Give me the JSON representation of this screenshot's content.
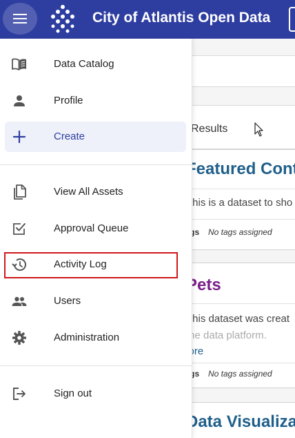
{
  "header": {
    "title": "City of Atlantis Open Data",
    "bg_color": "#2e3ea0",
    "menu_icon": "hamburger-menu-icon",
    "logo_icon": "diamond-dots-logo"
  },
  "drawer": {
    "primary_items": [
      {
        "label": "Data Catalog",
        "icon": "book-open-icon"
      },
      {
        "label": "Profile",
        "icon": "person-icon"
      },
      {
        "label": "Create",
        "icon": "plus-icon",
        "active": true
      }
    ],
    "secondary_items": [
      {
        "label": "View All Assets",
        "icon": "copy-documents-icon"
      },
      {
        "label": "Approval Queue",
        "icon": "checkbox-icon"
      },
      {
        "label": "Activity Log",
        "icon": "history-icon",
        "highlighted": true
      },
      {
        "label": "Users",
        "icon": "people-icon"
      },
      {
        "label": "Administration",
        "icon": "gear-icon"
      }
    ],
    "footer_items": [
      {
        "label": "Sign out",
        "icon": "sign-out-icon"
      }
    ],
    "highlight_color": "#d0161b"
  },
  "background": {
    "results_label": "Results",
    "cards": [
      {
        "title": "Featured Cont",
        "description": "This is a dataset to sho",
        "tags_key": "Tags",
        "tags_value": "No tags assigned"
      },
      {
        "title": "Pets",
        "description": "This dataset was creat",
        "description2": "the data platform.",
        "more": "More",
        "tags_key": "Tags",
        "tags_value": "No tags assigned"
      },
      {
        "title": "Data Visualiza"
      }
    ]
  }
}
